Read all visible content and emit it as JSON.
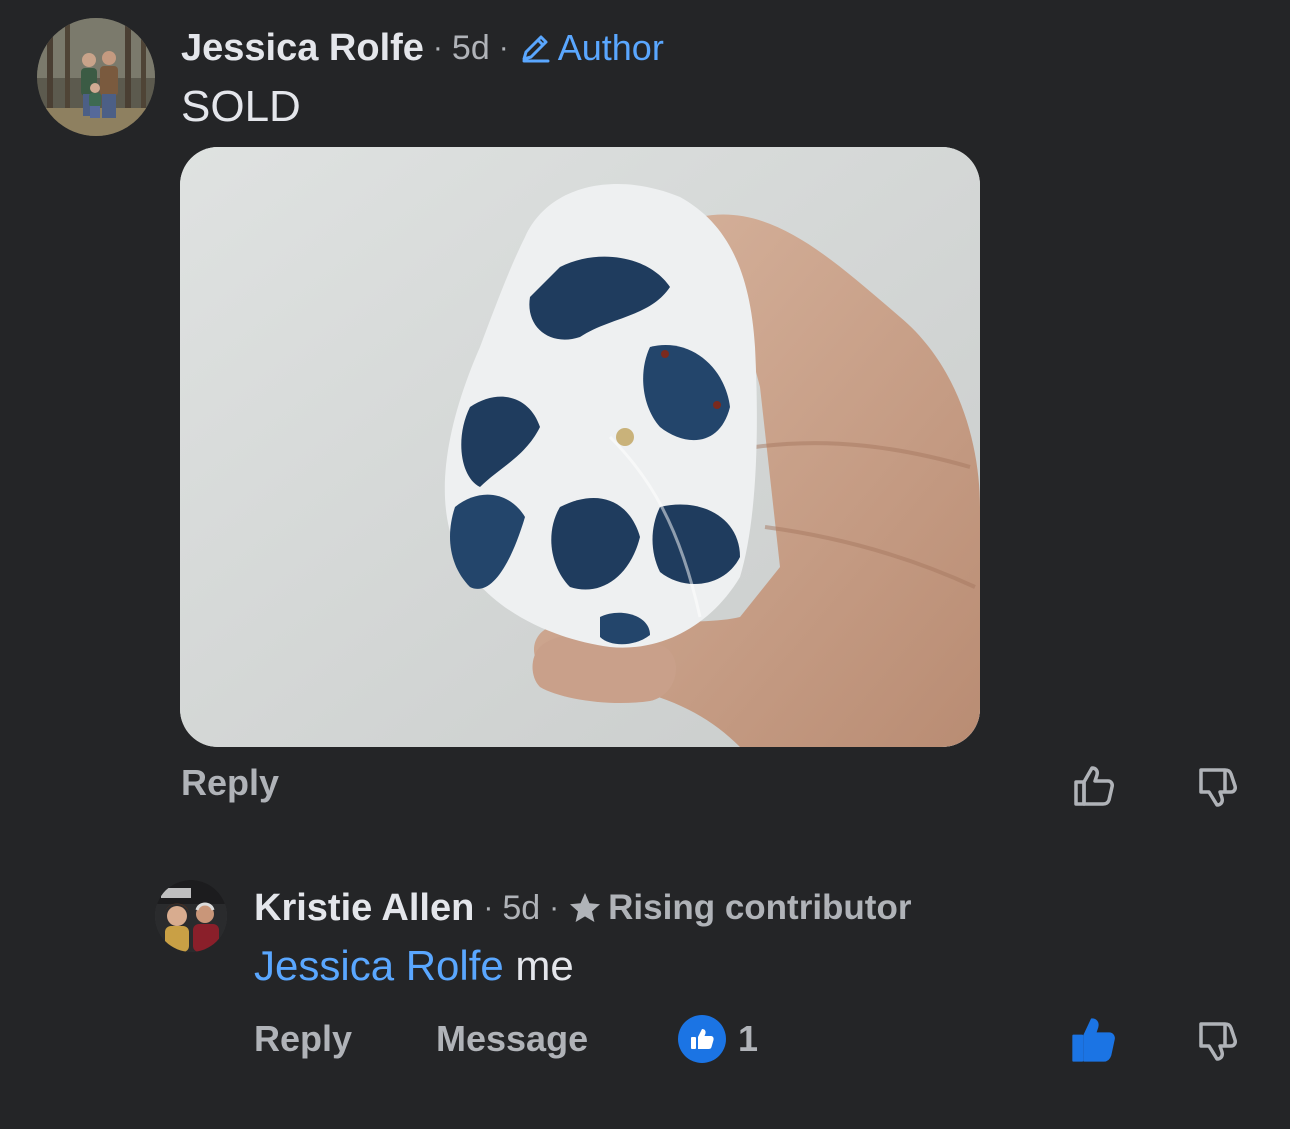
{
  "comment": {
    "author": "Jessica Rolfe",
    "time": "5d",
    "separator": "·",
    "badge": "Author",
    "text": "SOLD",
    "reply_label": "Reply"
  },
  "reply": {
    "author": "Kristie Allen",
    "time": "5d",
    "separator": "·",
    "badge": "Rising contributor",
    "mention": "Jessica Rolfe",
    "text": " me",
    "reply_label": "Reply",
    "message_label": "Message",
    "like_count": "1",
    "liked_by_viewer": true
  },
  "colors": {
    "background": "#242527",
    "text": "#e4e6eb",
    "muted": "#b0b3b8",
    "link": "#5aa7ff",
    "like_blue": "#1b74e4"
  },
  "icons": {
    "author_badge": "pencil-icon",
    "rising_badge": "star-icon",
    "like": "thumbs-up-icon",
    "dislike": "thumbs-down-icon"
  }
}
